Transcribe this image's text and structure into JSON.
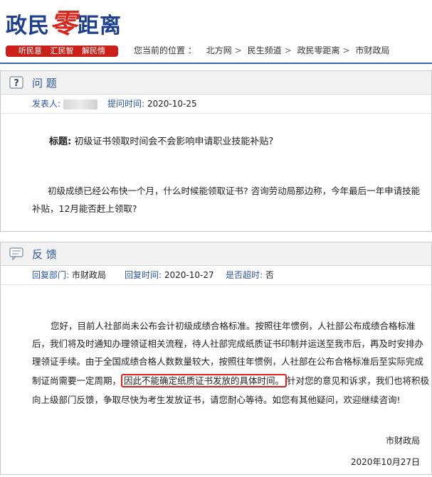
{
  "logo": {
    "part1": "政民",
    "part2": "零",
    "part3": "距离"
  },
  "slogan": "听民意 汇民智 解民情",
  "breadcrumb": {
    "label": "您当前的位置 ：",
    "items": [
      "北方网",
      "民生频道",
      "政民零距离",
      "市财政局"
    ]
  },
  "question": {
    "section_title": "问 题",
    "poster_label": "发表人:",
    "time_label": "提问时间:",
    "time_value": "2020-10-25",
    "title_label": "标题:",
    "title_value": "初级证书领取时间会不会影响申请职业技能补贴?",
    "body_line1": "初级成绩已经公布快一个月，什么时候能领取证书? 咨询劳动局那边称，今年最后一年申请技能",
    "body_line2": "补贴，12月能否赶上领取?"
  },
  "feedback": {
    "section_title": "反 馈",
    "dept_label": "回复部门:",
    "dept_value": "市财政局",
    "time_label": "回复时间:",
    "time_value": "2020-10-27",
    "overdue_label": "是否超时:",
    "overdue_value": "否",
    "line1": "您好，目前人社部尚未公布会计初级成绩合格标准。按照往年惯例，人社部公布成绩合格标准",
    "line2": "后，我们将及时通知办理领证相关流程，待人社部完成纸质证书印制并运送至我市后，再及时安排办",
    "line3": "理领证手续。由于全国成绩合格人数数量较大，按照往年惯例，人社部在公布合格标准后至实际完成",
    "line4_a": "制证尚需要一定周期，",
    "line4_hl": "因此不能确定纸质证书发放的具体时间。",
    "line4_b": "针对您的意见和诉求，我们也将积极",
    "line5": "向上级部门反馈，争取尽快为考生发放证书，请您耐心等待。如您有其他疑问，欢迎继续咨询!",
    "signature": "市财政局",
    "date": "2020年10月27日"
  },
  "colors": {
    "brand_blue": "#2a56a8",
    "brand_red": "#d9261c",
    "highlight": "#e21f1f"
  }
}
